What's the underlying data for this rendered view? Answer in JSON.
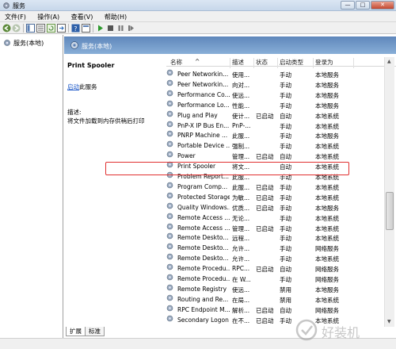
{
  "window": {
    "title": "服务"
  },
  "window_buttons": {
    "minimize": "—",
    "maximize": "□",
    "close": "✕"
  },
  "menu": [
    "文件(F)",
    "操作(A)",
    "查看(V)",
    "帮助(H)"
  ],
  "tree": {
    "root_label": "服务(本地)"
  },
  "pane": {
    "header_title": "服务(本地)"
  },
  "detail": {
    "service_name": "Print Spooler",
    "start_link": "启动",
    "start_suffix": "此服务",
    "description_label": "描述:",
    "description_text": "将文件加载到内存供稍后打印"
  },
  "columns": [
    "名称",
    "描述",
    "状态",
    "启动类型",
    "登录为"
  ],
  "rows": [
    {
      "name": "Peer Networkin...",
      "desc": "使用...",
      "status": "",
      "startup": "手动",
      "logon": "本地服务"
    },
    {
      "name": "Peer Networkin...",
      "desc": "向对...",
      "status": "",
      "startup": "手动",
      "logon": "本地服务"
    },
    {
      "name": "Performance Co...",
      "desc": "使远...",
      "status": "",
      "startup": "手动",
      "logon": "本地服务"
    },
    {
      "name": "Performance Lo...",
      "desc": "性能...",
      "status": "",
      "startup": "手动",
      "logon": "本地服务"
    },
    {
      "name": "Plug and Play",
      "desc": "使计...",
      "status": "已启动",
      "startup": "自动",
      "logon": "本地系统"
    },
    {
      "name": "PnP-X IP Bus En...",
      "desc": "PnP-...",
      "status": "",
      "startup": "手动",
      "logon": "本地系统"
    },
    {
      "name": "PNRP Machine ...",
      "desc": "此服...",
      "status": "",
      "startup": "手动",
      "logon": "本地服务"
    },
    {
      "name": "Portable Device ...",
      "desc": "强制...",
      "status": "",
      "startup": "手动",
      "logon": "本地系统"
    },
    {
      "name": "Power",
      "desc": "管理...",
      "status": "已启动",
      "startup": "自动",
      "logon": "本地系统"
    },
    {
      "name": "Print Spooler",
      "desc": "将文...",
      "status": "",
      "startup": "自动",
      "logon": "本地系统"
    },
    {
      "name": "Problem Report...",
      "desc": "此服...",
      "status": "",
      "startup": "手动",
      "logon": "本地系统"
    },
    {
      "name": "Program Comp...",
      "desc": "此服...",
      "status": "已启动",
      "startup": "手动",
      "logon": "本地系统"
    },
    {
      "name": "Protected Storage",
      "desc": "为敏...",
      "status": "已启动",
      "startup": "手动",
      "logon": "本地系统"
    },
    {
      "name": "Quality Windows...",
      "desc": "优质...",
      "status": "已启动",
      "startup": "手动",
      "logon": "本地服务"
    },
    {
      "name": "Remote Access ...",
      "desc": "无论...",
      "status": "",
      "startup": "手动",
      "logon": "本地系统"
    },
    {
      "name": "Remote Access ...",
      "desc": "管理...",
      "status": "已启动",
      "startup": "手动",
      "logon": "本地系统"
    },
    {
      "name": "Remote Deskto...",
      "desc": "远程...",
      "status": "",
      "startup": "手动",
      "logon": "本地系统"
    },
    {
      "name": "Remote Deskto...",
      "desc": "允许...",
      "status": "",
      "startup": "手动",
      "logon": "网络服务"
    },
    {
      "name": "Remote Deskto...",
      "desc": "允许...",
      "status": "",
      "startup": "手动",
      "logon": "本地系统"
    },
    {
      "name": "Remote Procedu...",
      "desc": "RPC...",
      "status": "已启动",
      "startup": "自动",
      "logon": "网络服务"
    },
    {
      "name": "Remote Procedu...",
      "desc": "在 W...",
      "status": "",
      "startup": "手动",
      "logon": "网络服务"
    },
    {
      "name": "Remote Registry",
      "desc": "使远...",
      "status": "",
      "startup": "禁用",
      "logon": "本地服务"
    },
    {
      "name": "Routing and Re...",
      "desc": "在局...",
      "status": "",
      "startup": "禁用",
      "logon": "本地系统"
    },
    {
      "name": "RPC Endpoint M...",
      "desc": "解析...",
      "status": "已启动",
      "startup": "自动",
      "logon": "网络服务"
    },
    {
      "name": "Secondary Logon",
      "desc": "在不...",
      "status": "已启动",
      "startup": "手动",
      "logon": "本地系统"
    }
  ],
  "highlighted_row": "Print Spooler",
  "tabs": [
    "扩展",
    "标准"
  ],
  "watermark": {
    "text": "好装机"
  },
  "colors": {
    "header_blue": "#6f96c7",
    "highlight_red": "#e03030",
    "link_blue": "#1a56c7"
  }
}
